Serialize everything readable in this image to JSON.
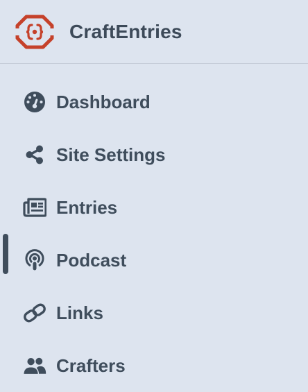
{
  "brand": {
    "name": "CraftEntries",
    "logo_icon": "craft-logo-icon",
    "logo_color": "#c5412a"
  },
  "nav": {
    "active_item": "Podcast",
    "items": [
      {
        "label": "Dashboard",
        "icon": "dashboard-gauge-icon"
      },
      {
        "label": "Site Settings",
        "icon": "share-nodes-icon"
      },
      {
        "label": "Entries",
        "icon": "newspaper-icon"
      },
      {
        "label": "Podcast",
        "icon": "podcast-icon"
      },
      {
        "label": "Links",
        "icon": "link-icon"
      },
      {
        "label": "Crafters",
        "icon": "users-icon"
      }
    ]
  },
  "colors": {
    "background": "#dde4ef",
    "text": "#3f4d5c",
    "accent": "#c5412a"
  }
}
